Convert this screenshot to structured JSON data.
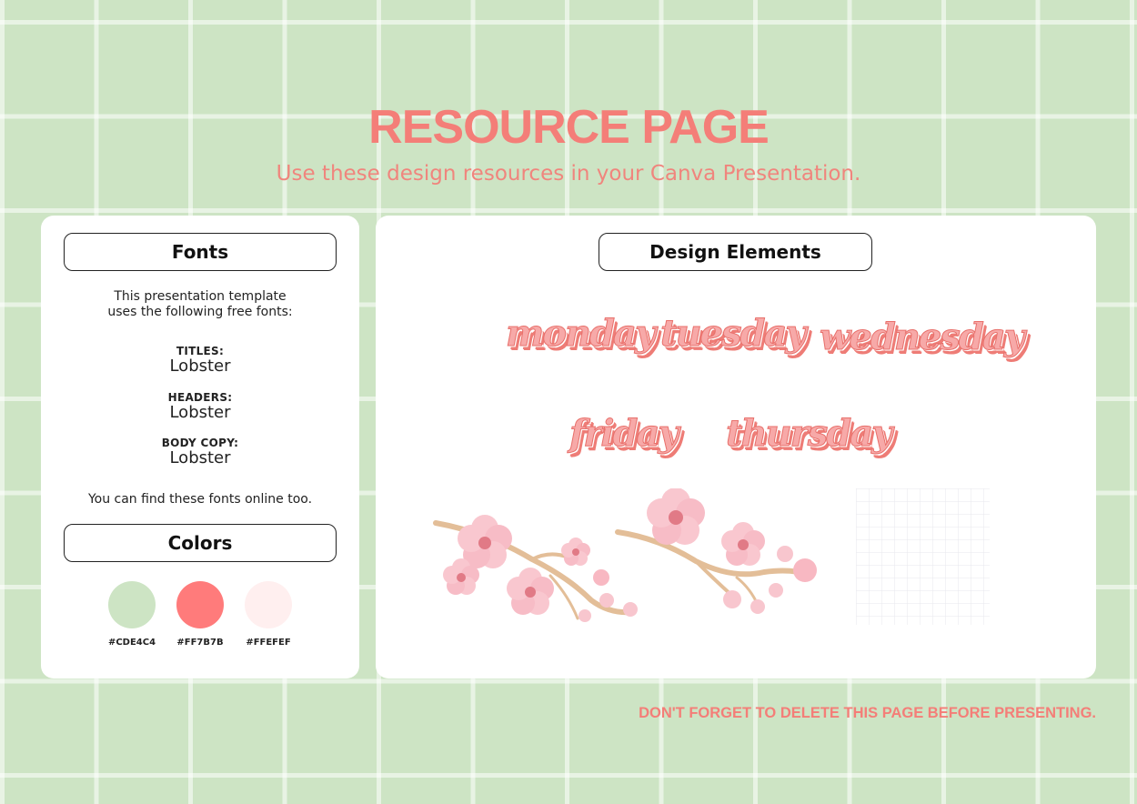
{
  "header": {
    "title": "RESOURCE PAGE",
    "subtitle": "Use these design resources in your Canva Presentation."
  },
  "fonts_panel": {
    "heading": "Fonts",
    "intro_line1": "This presentation template",
    "intro_line2": "uses the following free fonts:",
    "items": [
      {
        "label": "TITLES:",
        "value": "Lobster"
      },
      {
        "label": "HEADERS:",
        "value": "Lobster"
      },
      {
        "label": "BODY COPY:",
        "value": "Lobster"
      }
    ],
    "note": "You can find these fonts online too."
  },
  "colors_panel": {
    "heading": "Colors",
    "swatches": [
      {
        "hex": "#CDE4C4"
      },
      {
        "hex": "#FF7B7B"
      },
      {
        "hex": "#FFEFEF"
      }
    ]
  },
  "design_panel": {
    "heading": "Design Elements",
    "words": [
      "monday",
      "tuesday",
      "wednesday",
      "friday",
      "thursday"
    ],
    "icons": [
      "cherry-blossom-branch-icon",
      "cherry-blossom-branch-icon",
      "grid-paper-icon"
    ]
  },
  "footer": {
    "note": "DON'T FORGET TO DELETE THIS PAGE BEFORE PRESENTING."
  },
  "colors": {
    "background": "#CDE4C4",
    "accent": "#F47E78",
    "card": "#FFFFFF"
  }
}
